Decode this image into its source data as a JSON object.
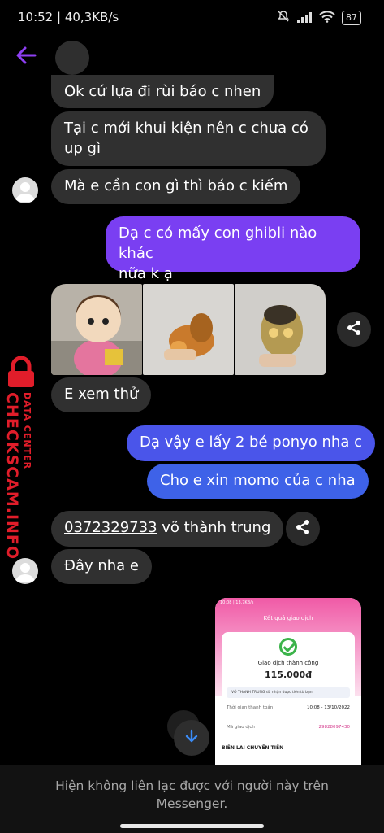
{
  "status_bar": {
    "time": "10:52 | 40,3KB/s",
    "battery": "87"
  },
  "icons": {
    "back": "arrow-left-icon",
    "share": "share-icon",
    "scroll_down": "arrow-down-icon",
    "mute": "notifications-off-icon",
    "signal": "signal-icon",
    "wifi": "wifi-icon"
  },
  "colors": {
    "accent": "#7a3ff2",
    "bubble_in": "#303030",
    "watermark": "#e11d2a"
  },
  "messages": [
    {
      "id": "m1",
      "direction": "in",
      "text": "Ok cứ lựa đi rùi báo c nhen"
    },
    {
      "id": "m2",
      "direction": "in",
      "line1": "Tại c  mới khui kiện nên c chưa có",
      "line2": "up gì"
    },
    {
      "id": "m3",
      "direction": "in",
      "text": "Mà e cần con gì thì báo c kiếm"
    },
    {
      "id": "m4",
      "direction": "out",
      "line1": "Dạ c có mấy con ghibli nào khác",
      "line2": "nữa k ạ"
    },
    {
      "id": "m5",
      "direction": "in",
      "text": "E xem thử"
    },
    {
      "id": "m6",
      "direction": "out",
      "text": "Dạ vậy e lấy 2 bé ponyo nha c"
    },
    {
      "id": "m7",
      "direction": "out",
      "text": "Cho e xin momo của c nha"
    },
    {
      "id": "m8",
      "direction": "in",
      "phone": "0372329733",
      "rest": " võ thành trung"
    },
    {
      "id": "m9",
      "direction": "in",
      "text": "Đây nha e"
    }
  ],
  "watermark": {
    "main": "CHECKSCAM.INFO",
    "sub": "DATA CENTER"
  },
  "receipt": {
    "status": "10:08 | 13,7KB/s",
    "title": "Kết quả giao dịch",
    "success": "Giao dịch thành công",
    "amount": "115.000đ",
    "note": "VÕ THÀNH TRUNG đã nhận được tiền từ bạn",
    "time_label": "Thời gian thanh toán",
    "time_value": "10:08 - 13/10/2022",
    "code_label": "Mã giao dịch",
    "code_value": "29828097430",
    "section": "BIÊN LAI CHUYỂN TIỀN"
  },
  "footer": {
    "line1": "Hiện không liên lạc được với người này trên",
    "line2": "Messenger."
  }
}
